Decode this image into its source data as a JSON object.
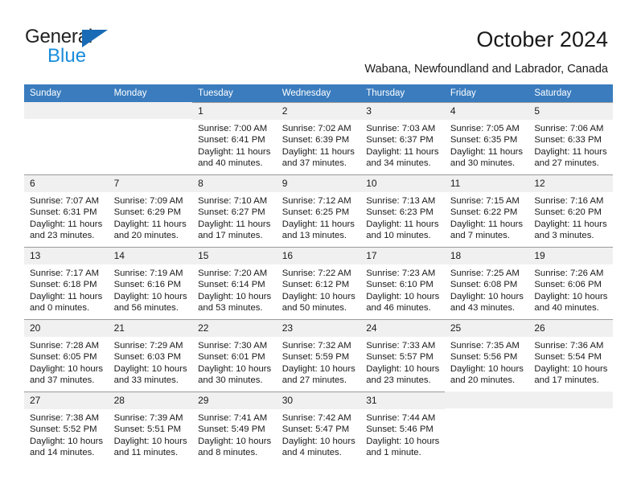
{
  "logo": {
    "word1": "General",
    "word2": "Blue",
    "triangle_color": "#1a6bb5",
    "blue_color": "#1a8cdb"
  },
  "header": {
    "title": "October 2024",
    "subtitle": "Wabana, Newfoundland and Labrador, Canada"
  },
  "theme": {
    "header_row_bg": "#3a7cbe",
    "day_number_bg": "#f0f0f0",
    "cell_border": "#9a9a9a",
    "text": "#1a1a1a"
  },
  "weekday_headers": [
    "Sunday",
    "Monday",
    "Tuesday",
    "Wednesday",
    "Thursday",
    "Friday",
    "Saturday"
  ],
  "weeks": [
    [
      {
        "day": "",
        "sunrise": "",
        "sunset": "",
        "daylight1": "",
        "daylight2": "",
        "empty": true
      },
      {
        "day": "",
        "sunrise": "",
        "sunset": "",
        "daylight1": "",
        "daylight2": "",
        "empty": true
      },
      {
        "day": "1",
        "sunrise": "Sunrise: 7:00 AM",
        "sunset": "Sunset: 6:41 PM",
        "daylight1": "Daylight: 11 hours",
        "daylight2": "and 40 minutes."
      },
      {
        "day": "2",
        "sunrise": "Sunrise: 7:02 AM",
        "sunset": "Sunset: 6:39 PM",
        "daylight1": "Daylight: 11 hours",
        "daylight2": "and 37 minutes."
      },
      {
        "day": "3",
        "sunrise": "Sunrise: 7:03 AM",
        "sunset": "Sunset: 6:37 PM",
        "daylight1": "Daylight: 11 hours",
        "daylight2": "and 34 minutes."
      },
      {
        "day": "4",
        "sunrise": "Sunrise: 7:05 AM",
        "sunset": "Sunset: 6:35 PM",
        "daylight1": "Daylight: 11 hours",
        "daylight2": "and 30 minutes."
      },
      {
        "day": "5",
        "sunrise": "Sunrise: 7:06 AM",
        "sunset": "Sunset: 6:33 PM",
        "daylight1": "Daylight: 11 hours",
        "daylight2": "and 27 minutes."
      }
    ],
    [
      {
        "day": "6",
        "sunrise": "Sunrise: 7:07 AM",
        "sunset": "Sunset: 6:31 PM",
        "daylight1": "Daylight: 11 hours",
        "daylight2": "and 23 minutes."
      },
      {
        "day": "7",
        "sunrise": "Sunrise: 7:09 AM",
        "sunset": "Sunset: 6:29 PM",
        "daylight1": "Daylight: 11 hours",
        "daylight2": "and 20 minutes."
      },
      {
        "day": "8",
        "sunrise": "Sunrise: 7:10 AM",
        "sunset": "Sunset: 6:27 PM",
        "daylight1": "Daylight: 11 hours",
        "daylight2": "and 17 minutes."
      },
      {
        "day": "9",
        "sunrise": "Sunrise: 7:12 AM",
        "sunset": "Sunset: 6:25 PM",
        "daylight1": "Daylight: 11 hours",
        "daylight2": "and 13 minutes."
      },
      {
        "day": "10",
        "sunrise": "Sunrise: 7:13 AM",
        "sunset": "Sunset: 6:23 PM",
        "daylight1": "Daylight: 11 hours",
        "daylight2": "and 10 minutes."
      },
      {
        "day": "11",
        "sunrise": "Sunrise: 7:15 AM",
        "sunset": "Sunset: 6:22 PM",
        "daylight1": "Daylight: 11 hours",
        "daylight2": "and 7 minutes."
      },
      {
        "day": "12",
        "sunrise": "Sunrise: 7:16 AM",
        "sunset": "Sunset: 6:20 PM",
        "daylight1": "Daylight: 11 hours",
        "daylight2": "and 3 minutes."
      }
    ],
    [
      {
        "day": "13",
        "sunrise": "Sunrise: 7:17 AM",
        "sunset": "Sunset: 6:18 PM",
        "daylight1": "Daylight: 11 hours",
        "daylight2": "and 0 minutes."
      },
      {
        "day": "14",
        "sunrise": "Sunrise: 7:19 AM",
        "sunset": "Sunset: 6:16 PM",
        "daylight1": "Daylight: 10 hours",
        "daylight2": "and 56 minutes."
      },
      {
        "day": "15",
        "sunrise": "Sunrise: 7:20 AM",
        "sunset": "Sunset: 6:14 PM",
        "daylight1": "Daylight: 10 hours",
        "daylight2": "and 53 minutes."
      },
      {
        "day": "16",
        "sunrise": "Sunrise: 7:22 AM",
        "sunset": "Sunset: 6:12 PM",
        "daylight1": "Daylight: 10 hours",
        "daylight2": "and 50 minutes."
      },
      {
        "day": "17",
        "sunrise": "Sunrise: 7:23 AM",
        "sunset": "Sunset: 6:10 PM",
        "daylight1": "Daylight: 10 hours",
        "daylight2": "and 46 minutes."
      },
      {
        "day": "18",
        "sunrise": "Sunrise: 7:25 AM",
        "sunset": "Sunset: 6:08 PM",
        "daylight1": "Daylight: 10 hours",
        "daylight2": "and 43 minutes."
      },
      {
        "day": "19",
        "sunrise": "Sunrise: 7:26 AM",
        "sunset": "Sunset: 6:06 PM",
        "daylight1": "Daylight: 10 hours",
        "daylight2": "and 40 minutes."
      }
    ],
    [
      {
        "day": "20",
        "sunrise": "Sunrise: 7:28 AM",
        "sunset": "Sunset: 6:05 PM",
        "daylight1": "Daylight: 10 hours",
        "daylight2": "and 37 minutes."
      },
      {
        "day": "21",
        "sunrise": "Sunrise: 7:29 AM",
        "sunset": "Sunset: 6:03 PM",
        "daylight1": "Daylight: 10 hours",
        "daylight2": "and 33 minutes."
      },
      {
        "day": "22",
        "sunrise": "Sunrise: 7:30 AM",
        "sunset": "Sunset: 6:01 PM",
        "daylight1": "Daylight: 10 hours",
        "daylight2": "and 30 minutes."
      },
      {
        "day": "23",
        "sunrise": "Sunrise: 7:32 AM",
        "sunset": "Sunset: 5:59 PM",
        "daylight1": "Daylight: 10 hours",
        "daylight2": "and 27 minutes."
      },
      {
        "day": "24",
        "sunrise": "Sunrise: 7:33 AM",
        "sunset": "Sunset: 5:57 PM",
        "daylight1": "Daylight: 10 hours",
        "daylight2": "and 23 minutes."
      },
      {
        "day": "25",
        "sunrise": "Sunrise: 7:35 AM",
        "sunset": "Sunset: 5:56 PM",
        "daylight1": "Daylight: 10 hours",
        "daylight2": "and 20 minutes."
      },
      {
        "day": "26",
        "sunrise": "Sunrise: 7:36 AM",
        "sunset": "Sunset: 5:54 PM",
        "daylight1": "Daylight: 10 hours",
        "daylight2": "and 17 minutes."
      }
    ],
    [
      {
        "day": "27",
        "sunrise": "Sunrise: 7:38 AM",
        "sunset": "Sunset: 5:52 PM",
        "daylight1": "Daylight: 10 hours",
        "daylight2": "and 14 minutes."
      },
      {
        "day": "28",
        "sunrise": "Sunrise: 7:39 AM",
        "sunset": "Sunset: 5:51 PM",
        "daylight1": "Daylight: 10 hours",
        "daylight2": "and 11 minutes."
      },
      {
        "day": "29",
        "sunrise": "Sunrise: 7:41 AM",
        "sunset": "Sunset: 5:49 PM",
        "daylight1": "Daylight: 10 hours",
        "daylight2": "and 8 minutes."
      },
      {
        "day": "30",
        "sunrise": "Sunrise: 7:42 AM",
        "sunset": "Sunset: 5:47 PM",
        "daylight1": "Daylight: 10 hours",
        "daylight2": "and 4 minutes."
      },
      {
        "day": "31",
        "sunrise": "Sunrise: 7:44 AM",
        "sunset": "Sunset: 5:46 PM",
        "daylight1": "Daylight: 10 hours",
        "daylight2": "and 1 minute."
      },
      {
        "day": "",
        "sunrise": "",
        "sunset": "",
        "daylight1": "",
        "daylight2": "",
        "empty": true
      },
      {
        "day": "",
        "sunrise": "",
        "sunset": "",
        "daylight1": "",
        "daylight2": "",
        "empty": true
      }
    ]
  ]
}
